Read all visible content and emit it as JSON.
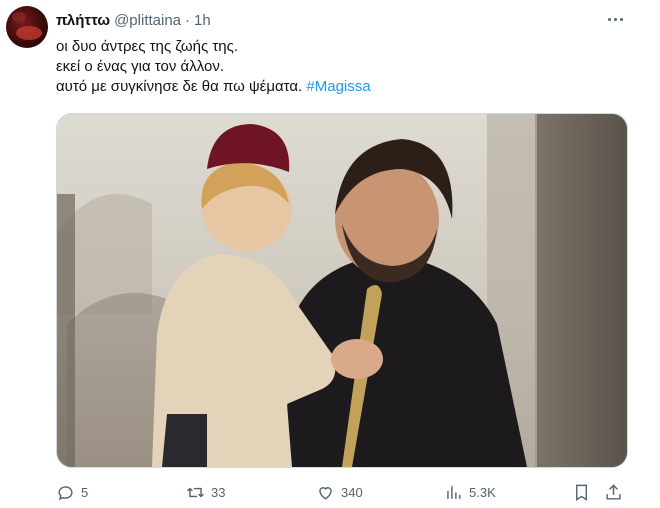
{
  "tweet": {
    "author_name": "πλήττω",
    "author_handle": "@plittaina",
    "separator": "·",
    "time": "1h",
    "text_lines": [
      "οι δυο άντρες της ζωής της.",
      "εκεί ο ένας για τον άλλον.",
      "αυτό με συγκίνησε δε θα πω ψέματα."
    ],
    "hashtag": "#Magissa"
  },
  "actions": {
    "reply_count": "5",
    "retweet_count": "33",
    "like_count": "340",
    "views_count": "5.3K"
  },
  "icons": {
    "more": "more-horizontal-icon",
    "reply": "reply-icon",
    "retweet": "retweet-icon",
    "like": "heart-icon",
    "views": "views-icon",
    "bookmark": "bookmark-icon",
    "share": "share-icon"
  },
  "colors": {
    "accent": "#1d9bf0",
    "secondary_text": "#536471",
    "primary_text": "#0f1419"
  }
}
